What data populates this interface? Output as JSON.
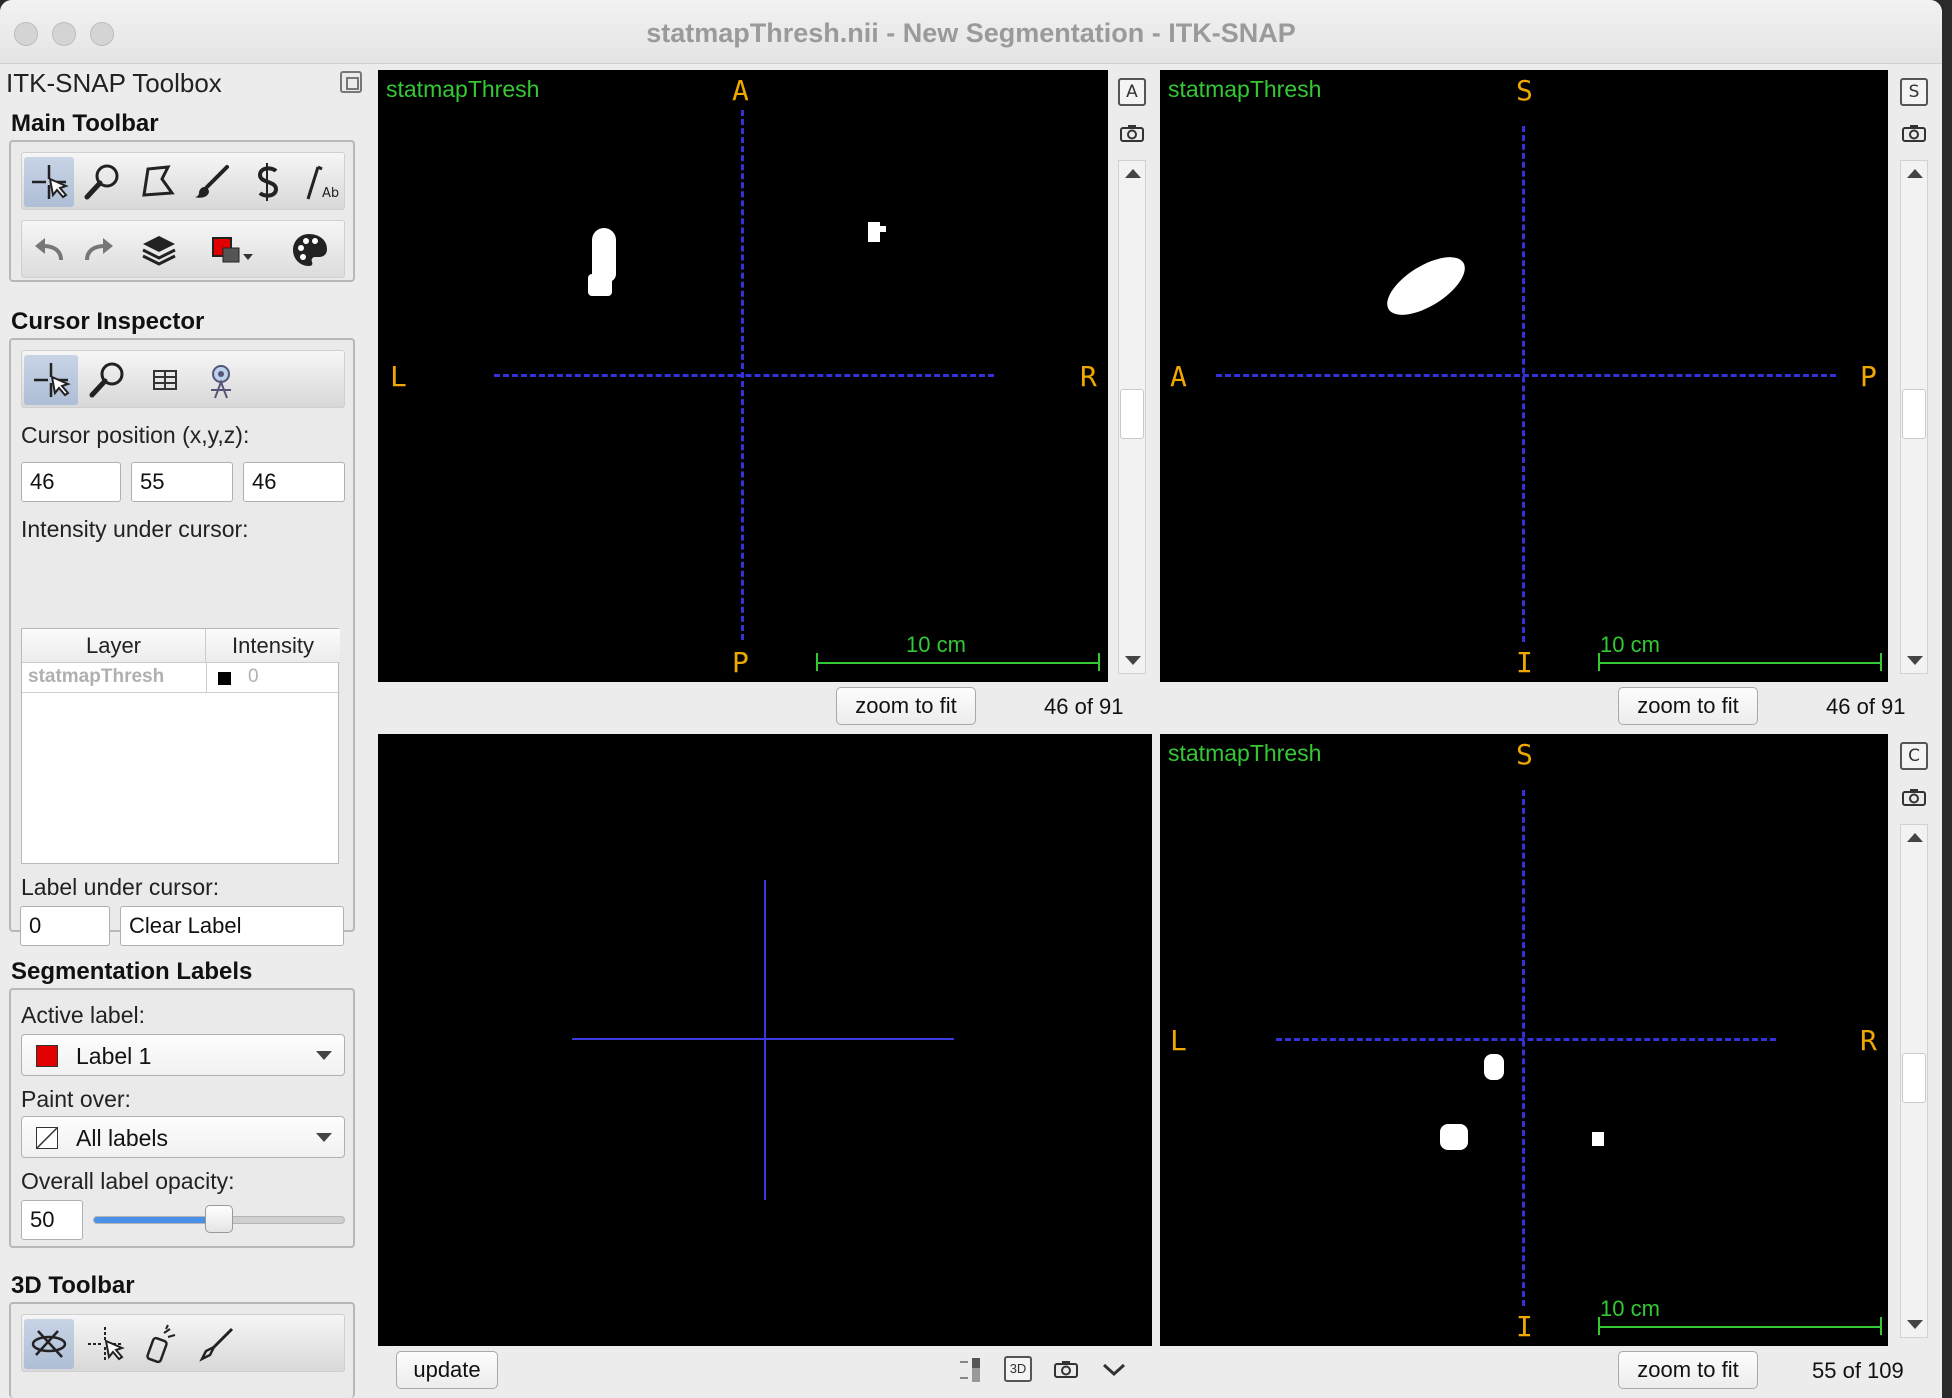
{
  "window": {
    "title": "statmapThresh.nii - New Segmentation - ITK-SNAP"
  },
  "toolbox": {
    "title": "ITK-SNAP Toolbox",
    "main_toolbar": "Main Toolbar",
    "cursor_inspector": "Cursor Inspector",
    "segmentation_labels": "Segmentation Labels",
    "toolbar_3d": "3D Toolbar"
  },
  "cursor": {
    "position_label": "Cursor position (x,y,z):",
    "x": "46",
    "y": "55",
    "z": "46",
    "intensity_label": "Intensity under cursor:",
    "table": {
      "columns": [
        "Layer",
        "Intensity"
      ],
      "rows": [
        {
          "layer": "statmapThresh",
          "intensity": "0"
        }
      ]
    },
    "label_under_label": "Label under cursor:",
    "label_value": "0",
    "label_name": "Clear Label"
  },
  "seg": {
    "active_label": "Active label:",
    "active_value": "Label 1",
    "active_color": "#e00000",
    "paint_over": "Paint over:",
    "paint_value": "All labels",
    "opacity_label": "Overall label opacity:",
    "opacity_value": "50",
    "opacity_fraction": 0.5
  },
  "views": {
    "axial": {
      "layer": "statmapThresh",
      "top": "A",
      "bottom": "P",
      "left": "L",
      "right": "R",
      "scale": "10 cm",
      "button": "zoom to fit",
      "slice": "46 of 91",
      "corner": "A"
    },
    "sagittal": {
      "layer": "statmapThresh",
      "top": "S",
      "bottom": "I",
      "left": "A",
      "right": "P",
      "scale": "10 cm",
      "button": "zoom to fit",
      "slice": "46 of 91",
      "corner": "S"
    },
    "coronal": {
      "layer": "statmapThresh",
      "top": "S",
      "bottom": "I",
      "left": "L",
      "right": "R",
      "scale": "10 cm",
      "button": "zoom to fit",
      "slice": "55 of 109",
      "corner": "C"
    },
    "three_d": {
      "button": "update",
      "mode": "3D"
    }
  },
  "colors": {
    "accent": "#34c934",
    "orientation": "#f0a800",
    "crosshair": "#3232d8"
  }
}
